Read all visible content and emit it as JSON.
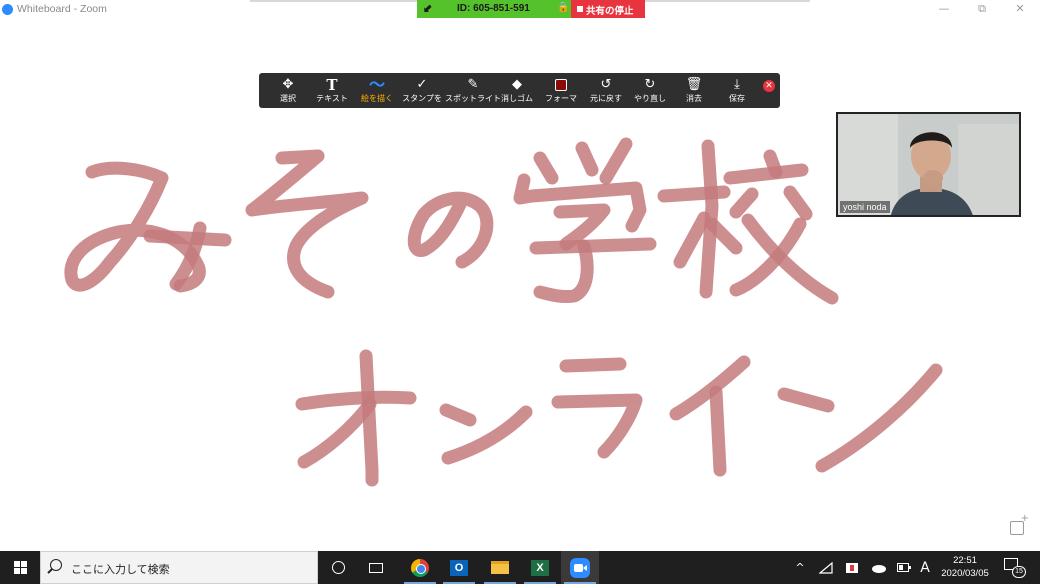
{
  "window": {
    "title": "Whiteboard - Zoom",
    "minimize": "—",
    "restore": "⧉",
    "close": "✕"
  },
  "share_banner": {
    "meeting_id": "ID: 605-851-591",
    "stop_label": "共有の停止",
    "green": "#55c12b",
    "red": "#e8343f"
  },
  "toolbar": {
    "tools": [
      {
        "name": "select",
        "label": "選択",
        "icon": "move-icon",
        "glyph": "✥"
      },
      {
        "name": "text",
        "label": "テキスト",
        "icon": "text-icon",
        "glyph": "T"
      },
      {
        "name": "draw",
        "label": "絵を描く",
        "icon": "draw-icon",
        "glyph": "〜",
        "active": true
      },
      {
        "name": "stamp",
        "label": "スタンプを",
        "icon": "check-icon",
        "glyph": "✓"
      },
      {
        "name": "spotlight",
        "label": "スポットライト",
        "icon": "wand-icon",
        "glyph": "✎"
      },
      {
        "name": "eraser",
        "label": "消しゴム",
        "icon": "eraser-icon",
        "glyph": "◆"
      },
      {
        "name": "format",
        "label": "フォーマ",
        "icon": "color-icon",
        "glyph": ""
      },
      {
        "name": "undo",
        "label": "元に戻す",
        "icon": "undo-icon",
        "glyph": "↺"
      },
      {
        "name": "redo",
        "label": "やり直し",
        "icon": "redo-icon",
        "glyph": "↻"
      },
      {
        "name": "clear",
        "label": "消去",
        "icon": "trash-icon",
        "glyph": "🗑"
      },
      {
        "name": "save",
        "label": "保存",
        "icon": "save-icon",
        "glyph": "⤓"
      }
    ],
    "close": "✕",
    "format_color": "#8b0a0a"
  },
  "video": {
    "participant_name": "yoshi noda"
  },
  "taskbar": {
    "search_placeholder": "ここに入力して検索",
    "time": "22:51",
    "date": "2020/03/05",
    "notification_count": "15",
    "ime": "A",
    "tray_chevron": "^"
  },
  "colors": {
    "ink": "#c47a7c",
    "toolbar_bg": "#2f2f2f",
    "taskbar_bg": "#1f1f1f",
    "zoom_blue": "#2d8cff"
  }
}
